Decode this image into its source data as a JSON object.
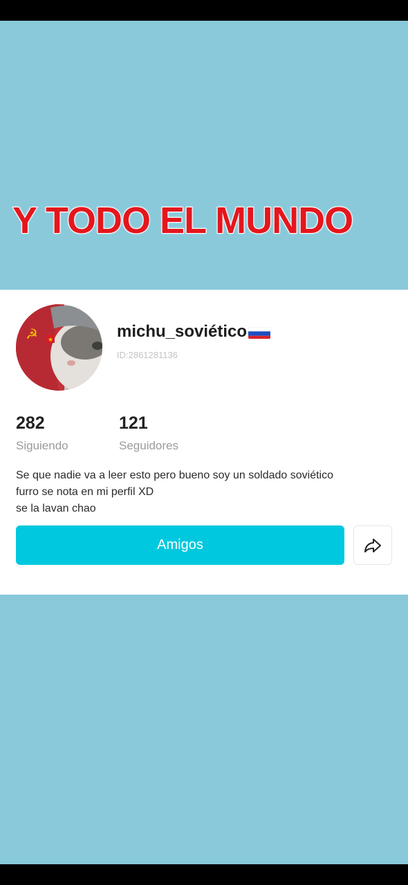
{
  "caption": "Y TODO EL MUNDO",
  "profile": {
    "username": "michu_soviético",
    "id_label": "ID:2861281136",
    "following_count": "282",
    "following_label": "Siguiendo",
    "followers_count": "121",
    "followers_label": "Seguidores",
    "bio_lines": [
      "Se que nadie va a leer esto pero bueno soy un soldado soviético",
      "furro se nota en mi perfil XD",
      "se la lavan chao"
    ]
  },
  "actions": {
    "friends_label": "Amigos",
    "share_icon": "share-arrow-icon"
  },
  "colors": {
    "background": "#89c9da",
    "caption": "#e5161d",
    "button": "#00c8df"
  }
}
